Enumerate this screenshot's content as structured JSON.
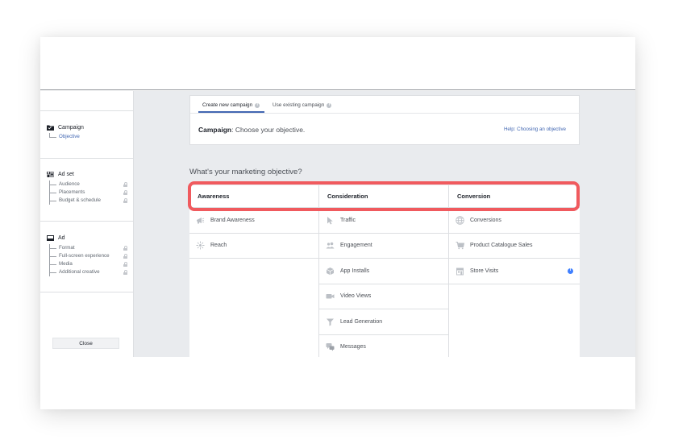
{
  "sidebar": {
    "sections": [
      {
        "title": "Campaign",
        "icon": "folder-icon",
        "items": [
          {
            "label": "Objective",
            "active": true,
            "locked": false
          }
        ]
      },
      {
        "title": "Ad set",
        "icon": "grid-icon",
        "items": [
          {
            "label": "Audience",
            "locked": true
          },
          {
            "label": "Placements",
            "locked": true
          },
          {
            "label": "Budget & schedule",
            "locked": true
          }
        ]
      },
      {
        "title": "Ad",
        "icon": "ad-window-icon",
        "items": [
          {
            "label": "Format",
            "locked": true
          },
          {
            "label": "Full-screen experience",
            "locked": true
          },
          {
            "label": "Media",
            "locked": true
          },
          {
            "label": "Additional creative",
            "locked": true
          }
        ]
      }
    ],
    "close_label": "Close"
  },
  "tabs": [
    {
      "label": "Create new campaign",
      "active": true,
      "icon": "info-icon"
    },
    {
      "label": "Use existing campaign",
      "active": false,
      "icon": "info-icon"
    }
  ],
  "panel": {
    "title_bold": "Campaign",
    "title_rest": ": Choose your objective.",
    "help_link": "Help: Choosing an objective"
  },
  "question": "What's your marketing objective?",
  "objectives": {
    "columns": [
      {
        "header": "Awareness",
        "items": [
          {
            "label": "Brand Awareness",
            "icon": "megaphone-icon"
          },
          {
            "label": "Reach",
            "icon": "reach-burst-icon"
          }
        ]
      },
      {
        "header": "Consideration",
        "items": [
          {
            "label": "Traffic",
            "icon": "cursor-icon"
          },
          {
            "label": "Engagement",
            "icon": "people-icon"
          },
          {
            "label": "App Installs",
            "icon": "cube-icon"
          },
          {
            "label": "Video Views",
            "icon": "video-camera-icon"
          },
          {
            "label": "Lead Generation",
            "icon": "funnel-icon"
          },
          {
            "label": "Messages",
            "icon": "chat-bubbles-icon"
          }
        ]
      },
      {
        "header": "Conversion",
        "items": [
          {
            "label": "Conversions",
            "icon": "globe-icon"
          },
          {
            "label": "Product Catalogue Sales",
            "icon": "shopping-cart-icon"
          },
          {
            "label": "Store Visits",
            "icon": "store-icon",
            "info": true
          }
        ]
      }
    ]
  },
  "colors": {
    "accent": "#4267b2",
    "highlight": "#f05a5e",
    "info_blue": "#4080ff",
    "background": "#e9ebee"
  }
}
